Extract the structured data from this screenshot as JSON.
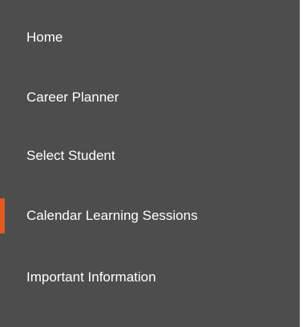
{
  "nav": {
    "items": [
      {
        "label": "Home",
        "active": false
      },
      {
        "label": "Career Planner",
        "active": false
      },
      {
        "label": "Select Student",
        "active": false
      },
      {
        "label": "Calendar Learning Sessions",
        "active": true
      },
      {
        "label": "Important Information",
        "active": false
      }
    ]
  },
  "colors": {
    "panel_background": "#4d4d4d",
    "text": "#ffffff",
    "active_accent": "#e35a20"
  }
}
